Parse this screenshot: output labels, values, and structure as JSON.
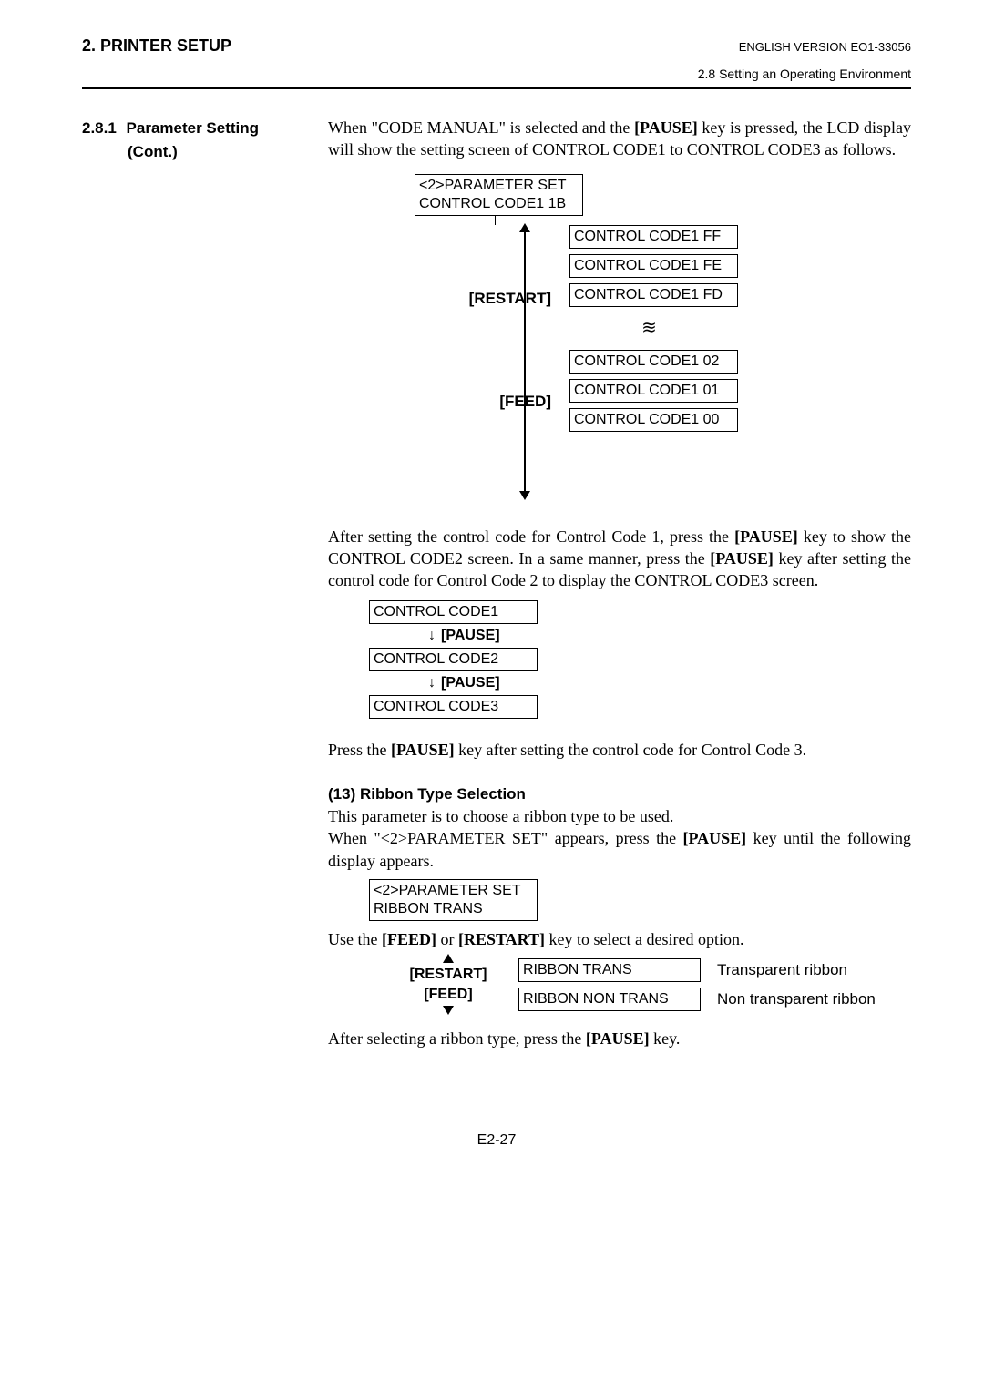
{
  "header": {
    "chapter": "2. PRINTER SETUP",
    "version": "ENGLISH VERSION EO1-33056",
    "section": "2.8 Setting an Operating Environment"
  },
  "sidebar": {
    "num": "2.8.1",
    "title": "Parameter Setting",
    "cont": "(Cont.)"
  },
  "para1_a": "When \"CODE MANUAL\" is selected and the ",
  "para1_b": "[PAUSE]",
  "para1_c": " key is pressed, the LCD display will show the setting screen of CONTROL CODE1 to CONTROL CODE3 as follows.",
  "diagram1": {
    "top_box": "<2>PARAMETER SET\nCONTROL CODE1 1B",
    "nav_up": "[RESTART]",
    "nav_down": "[FEED]",
    "options": [
      "CONTROL CODE1 FF",
      "CONTROL CODE1 FE",
      "CONTROL CODE1 FD"
    ],
    "options_bottom": [
      "CONTROL CODE1 02",
      "CONTROL CODE1 01",
      "CONTROL CODE1 00"
    ]
  },
  "para2_a": "After setting the control code for Control Code 1, press the ",
  "para2_b": "[PAUSE]",
  "para2_c": " key to show the CONTROL CODE2 screen.  In a same manner, press the ",
  "para2_d": "[PAUSE]",
  "para2_e": " key after setting the control code for Control Code 2 to display the CONTROL CODE3 screen.",
  "diagram2": {
    "box1": "CONTROL CODE1",
    "pause": "[PAUSE]",
    "box2": "CONTROL CODE2",
    "box3": "CONTROL CODE3"
  },
  "para3_a": "Press the ",
  "para3_b": "[PAUSE]",
  "para3_c": " key after setting the control code for Control Code 3.",
  "sec13": {
    "heading": "(13)   Ribbon Type Selection",
    "p1": "This parameter is to choose a ribbon type to be used.",
    "p2_a": "When \"<2>PARAMETER SET\" appears, press the ",
    "p2_b": "[PAUSE]",
    "p2_c": " key until the following display appears.",
    "box": "<2>PARAMETER SET\nRIBBON  TRANS",
    "p3_a": "Use the ",
    "p3_b": "[FEED]",
    "p3_c": " or ",
    "p3_d": "[RESTART]",
    "p3_e": " key to select a desired option.",
    "nav_up": "[RESTART]",
    "nav_down": "[FEED]",
    "opt1": "RIBBON  TRANS",
    "opt1_desc": "Transparent ribbon",
    "opt2": "RIBBON  NON TRANS",
    "opt2_desc": "Non transparent ribbon",
    "p4_a": "After selecting a ribbon type, press the ",
    "p4_b": "[PAUSE]",
    "p4_c": " key."
  },
  "footer": "E2-27"
}
